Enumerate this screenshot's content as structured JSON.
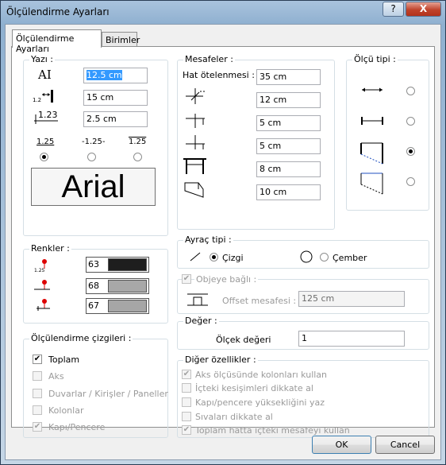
{
  "window": {
    "title": "Ölçülendirme Ayarları",
    "help": "?",
    "close": "X"
  },
  "tabs": [
    "Ölçülendirme Ayarları",
    "Birimler"
  ],
  "yazi": {
    "legend": "Yazı :",
    "height_value": "12.5 cm",
    "gap_value": "15 cm",
    "offset_value": "2.5 cm",
    "style_samples": [
      "1.25",
      "-1.25-",
      "1.25"
    ],
    "selected_style": 0,
    "font_button": "Arial"
  },
  "renkler": {
    "legend": "Renkler :",
    "items": [
      {
        "value": "63",
        "color": "#1e1e1e"
      },
      {
        "value": "68",
        "color": "#a8a8a8"
      },
      {
        "value": "67",
        "color": "#a6a6a6"
      }
    ]
  },
  "cizgiler": {
    "legend": "Ölçülendirme çizgileri :",
    "items": [
      {
        "label": "Toplam",
        "checked": true,
        "enabled": true
      },
      {
        "label": "Aks",
        "checked": false,
        "enabled": false
      },
      {
        "label": "Duvarlar / Kirişler / Paneller",
        "checked": false,
        "enabled": false
      },
      {
        "label": "Kolonlar",
        "checked": false,
        "enabled": false
      },
      {
        "label": "Kapı/Pencere",
        "checked": true,
        "enabled": false
      }
    ]
  },
  "mesafeler": {
    "legend": "Mesafeler :",
    "label": "Hat ötelenmesi :",
    "values": [
      "35 cm",
      "12 cm",
      "5 cm",
      "5 cm",
      "8 cm",
      "10 cm"
    ]
  },
  "olcu_tipi": {
    "legend": "Ölçü tipi :",
    "selected": 2
  },
  "ayrac": {
    "legend": "Ayraç tipi :",
    "options": [
      "Çizgi",
      "Çember"
    ],
    "selected": 0
  },
  "obje": {
    "legend": "Objeye bağlı :",
    "label": "Offset mesafesi :",
    "value": "125 cm",
    "checked": true
  },
  "deger": {
    "legend": "Değer :",
    "label": "Ölçek değeri",
    "value": "1"
  },
  "diger": {
    "legend": "Diğer özellikler :",
    "items": [
      {
        "label": "Aks ölçüsünde kolonları kullan",
        "checked": true
      },
      {
        "label": "İçteki kesişimleri dikkate al",
        "checked": false
      },
      {
        "label": "Kapı/pencere yüksekliğini yaz",
        "checked": false
      },
      {
        "label": "Sıvaları dikkate al",
        "checked": false
      },
      {
        "label": "Toplam hatta içteki mesafeyi kullan",
        "checked": true
      }
    ]
  },
  "buttons": {
    "ok": "OK",
    "cancel": "Cancel"
  }
}
